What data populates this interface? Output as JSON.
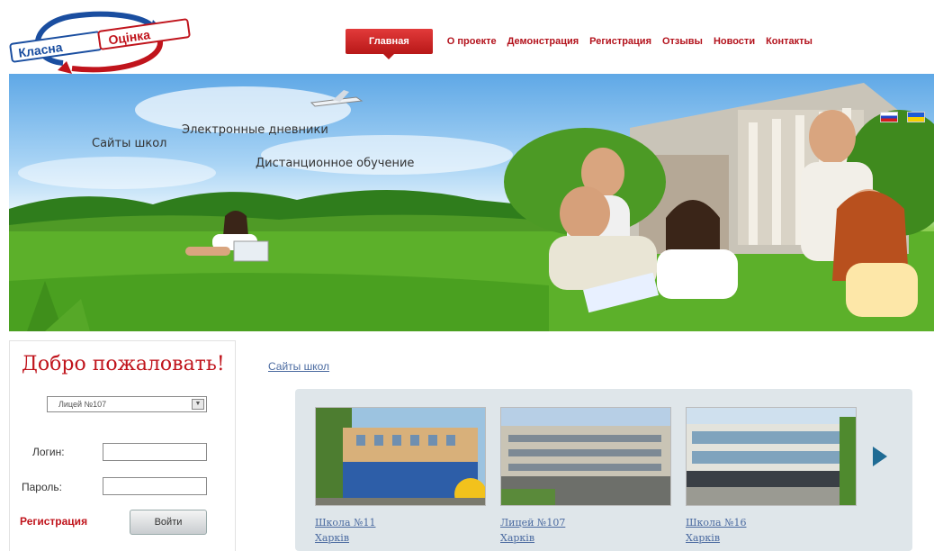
{
  "logo": {
    "text_top": "Класна",
    "text_bottom": "Оцінка"
  },
  "nav": {
    "items": [
      {
        "label": "Главная",
        "active": true
      },
      {
        "label": "О проекте"
      },
      {
        "label": "Демонстрация"
      },
      {
        "label": "Регистрация"
      },
      {
        "label": "Отзывы"
      },
      {
        "label": "Новости"
      },
      {
        "label": "Контакты"
      }
    ]
  },
  "banner": {
    "line1": "Электронные дневники",
    "line2": "Сайты школ",
    "line3": "Дистанционное обучение",
    "flags": [
      "ru-flag-icon",
      "ua-flag-icon"
    ]
  },
  "login": {
    "welcome": "Добро пожаловать!",
    "school_selected": "Лицей №107",
    "login_label": "Логин:",
    "password_label": "Пароль:",
    "register": "Регистрация",
    "submit": "Войти"
  },
  "sites": {
    "link": "Сайты школ",
    "schools": [
      {
        "name": "Школа №11",
        "city": "Харків"
      },
      {
        "name": "Лицей №107",
        "city": "Харків"
      },
      {
        "name": "Школа №16",
        "city": "Харків"
      }
    ]
  },
  "colors": {
    "accent": "#c0141c",
    "link": "#4a6aa0",
    "gallery_bg": "#dfe6ea",
    "arrow": "#1f6b94"
  }
}
